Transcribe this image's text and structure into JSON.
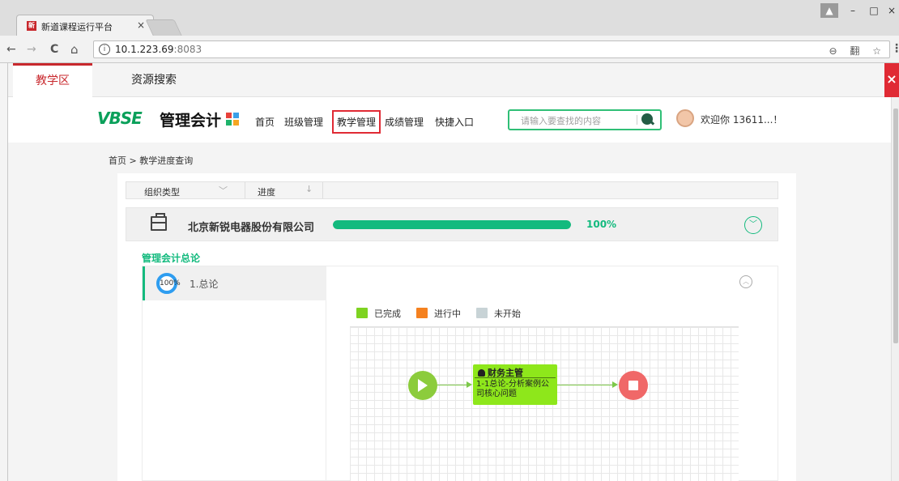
{
  "browser": {
    "tab_title": "新道课程运行平台",
    "tab_favicon_text": "新道",
    "tab_close": "×",
    "url_host": "10.1.223.69",
    "url_port": ":8083",
    "nav_back": "←",
    "nav_forward": "→",
    "nav_reload": "C",
    "nav_home": "⌂",
    "info": "i",
    "omni_icons": "⊖ 翻 ☆",
    "menu": "⋮",
    "win_min": "–",
    "win_max": "□",
    "win_close": "×"
  },
  "zones": {
    "active": "教学区",
    "other": "资源搜索",
    "close": "×"
  },
  "header": {
    "logo": "VBSE",
    "logo_sub": "管理会计",
    "nav": [
      "首页",
      "班级管理",
      "教学管理",
      "成绩管理",
      "快捷入口"
    ],
    "selected_nav": "教学管理",
    "search_placeholder": "请输入要查找的内容",
    "welcome": "欢迎你 13611...！"
  },
  "breadcrumb": "首页 > 教学进度查询",
  "filters": {
    "org_type": "组织类型",
    "org_type_arrow": "﹀",
    "progress": "进度",
    "progress_arrow": "↓"
  },
  "org": {
    "name": "北京新锐电器股份有限公司",
    "progress_percent": 100,
    "progress_label": "100%",
    "expand": "﹀"
  },
  "section_title": "管理会计总论",
  "chapter": {
    "ring_label": "100%",
    "label": "1.总论",
    "collapse": "︿"
  },
  "legend": [
    {
      "label": "已完成",
      "color": "#7ed321"
    },
    {
      "label": "进行中",
      "color": "#f5811f"
    },
    {
      "label": "未开始",
      "color": "#c8d3d6"
    }
  ],
  "flow": {
    "task_role": "财务主管",
    "task_desc": "1-1总论-分析案例公司核心问题"
  },
  "colors": {
    "accent_green": "#13ba7e",
    "brand_red": "#c8282d"
  }
}
